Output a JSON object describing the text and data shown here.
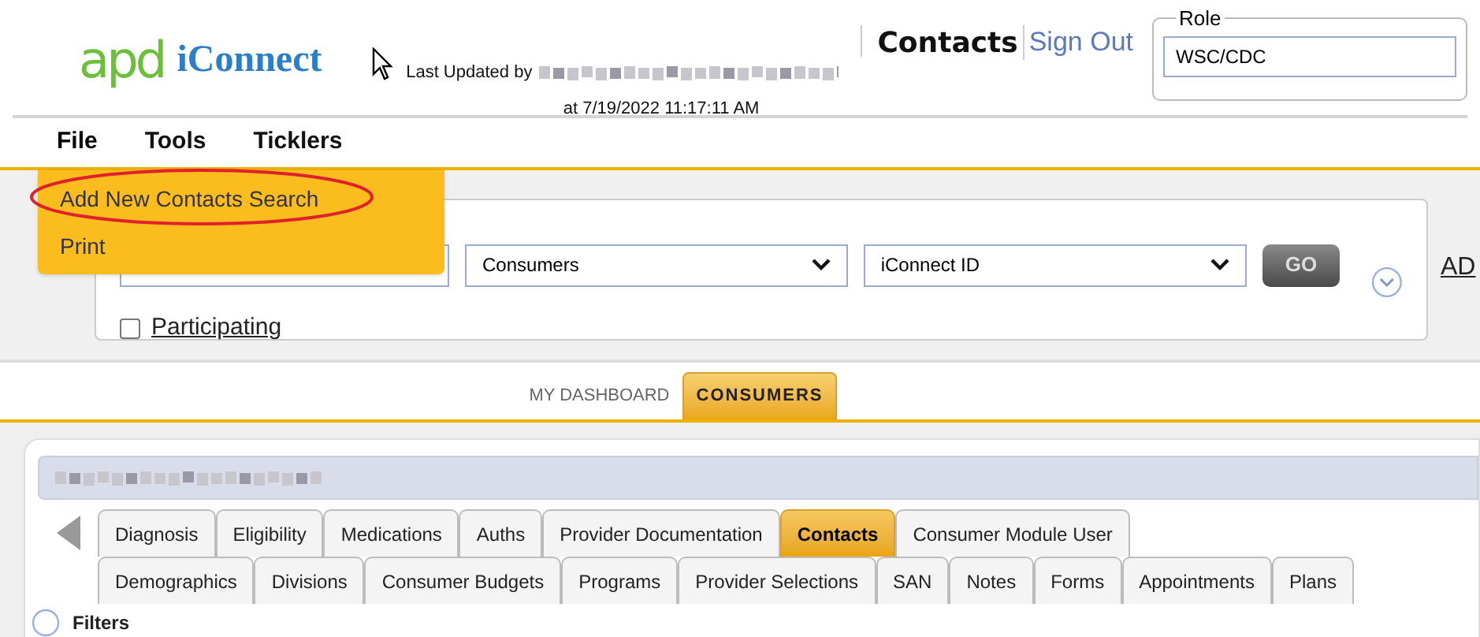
{
  "logo": {
    "mark": "apd",
    "name": "iConnect"
  },
  "last_updated": {
    "label": "Last Updated by",
    "at": "at 7/19/2022 11:17:11 AM"
  },
  "page_title": "Contacts",
  "sign_out": "Sign Out",
  "role": {
    "legend": "Role",
    "value": "WSC/CDC"
  },
  "menu": [
    {
      "label": "File",
      "expanded": true
    },
    {
      "label": "Tools",
      "expanded": false
    },
    {
      "label": "Ticklers",
      "expanded": false
    }
  ],
  "file_menu": [
    {
      "label": "Add New Contacts Search",
      "highlighted": true
    },
    {
      "label": "Print",
      "highlighted": false
    }
  ],
  "search": {
    "type": "Consumers",
    "field": "iConnect ID",
    "go": "GO",
    "participating": {
      "label": "Participating",
      "checked": false
    },
    "advanced": "AD"
  },
  "main_tabs": [
    {
      "label": "MY DASHBOARD",
      "selected": false
    },
    {
      "label": "CONSUMERS",
      "selected": true
    }
  ],
  "consumer_tabs_top": [
    {
      "label": "Diagnosis",
      "selected": false
    },
    {
      "label": "Eligibility",
      "selected": false
    },
    {
      "label": "Medications",
      "selected": false
    },
    {
      "label": "Auths",
      "selected": false
    },
    {
      "label": "Provider Documentation",
      "selected": false
    },
    {
      "label": "Contacts",
      "selected": true
    },
    {
      "label": "Consumer Module User",
      "selected": false
    }
  ],
  "consumer_tabs_bottom": [
    {
      "label": "Demographics",
      "selected": false
    },
    {
      "label": "Divisions",
      "selected": false
    },
    {
      "label": "Consumer Budgets",
      "selected": false
    },
    {
      "label": "Programs",
      "selected": false
    },
    {
      "label": "Provider Selections",
      "selected": false
    },
    {
      "label": "SAN",
      "selected": false
    },
    {
      "label": "Notes",
      "selected": false
    },
    {
      "label": "Forms",
      "selected": false
    },
    {
      "label": "Appointments",
      "selected": false
    },
    {
      "label": "Plans",
      "selected": false
    }
  ],
  "filters": "Filters"
}
